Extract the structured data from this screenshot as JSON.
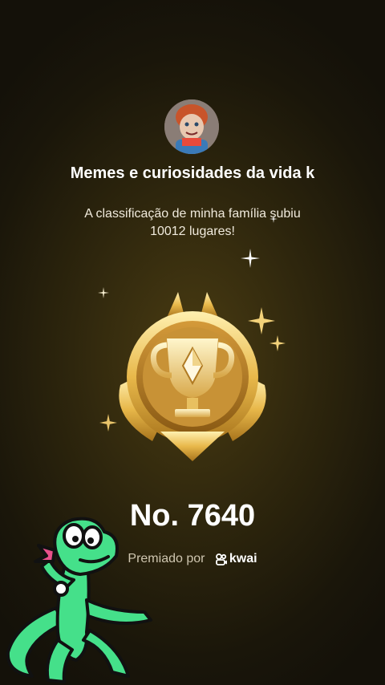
{
  "header": {
    "channel_name": "Memes e curiosidades da vida k",
    "message_line1": "A classificação de minha família subiu",
    "message_line2": "10012 lugares!"
  },
  "medal": {
    "icon": "trophy-medal-icon"
  },
  "rank": {
    "text": "No. 7640"
  },
  "award": {
    "prefix": "Premiado por",
    "brand": "kwai",
    "brand_icon": "kwai-logo-icon"
  },
  "colors": {
    "gold": "#e8c060",
    "background": "#2e260d",
    "lizard_green": "#45e08a"
  }
}
